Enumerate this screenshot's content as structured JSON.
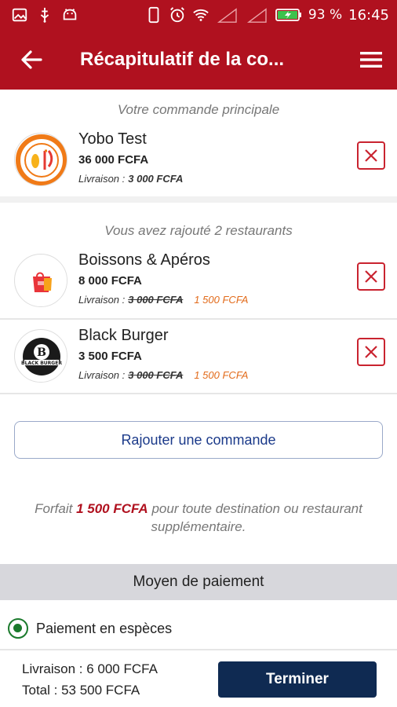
{
  "status_bar": {
    "battery": "93 %",
    "time": "16:45",
    "left_icons": [
      "image-icon",
      "usb-icon",
      "android-icon"
    ],
    "right_icons": [
      "phone-icon",
      "alarm-icon",
      "wifi-icon",
      "signal-icon",
      "signal-icon",
      "battery-icon"
    ]
  },
  "app_bar": {
    "title": "Récapitulatif de la co...",
    "back_icon": "arrow-left-icon",
    "menu_icon": "hamburger-menu-icon"
  },
  "main_order": {
    "section_title": "Votre commande principale",
    "name": "Yobo Test",
    "price": "36 000 FCFA",
    "delivery_label": "Livraison :",
    "delivery_fee": "3 000 FCFA"
  },
  "added": {
    "section_title": "Vous avez rajouté 2 restaurants",
    "items": [
      {
        "name": "Boissons & Apéros",
        "price": "8 000 FCFA",
        "delivery_label": "Livraison :",
        "old_fee": "3 000 FCFA",
        "new_fee": "1 500 FCFA"
      },
      {
        "name": "Black Burger",
        "price": "3 500 FCFA",
        "delivery_label": "Livraison :",
        "old_fee": "3 000 FCFA",
        "new_fee": "1 500 FCFA"
      }
    ]
  },
  "add_order_button": "Rajouter une commande",
  "note": {
    "prefix": "Forfait",
    "amount": "1 500 FCFA",
    "suffix": "pour toute destination ou restaurant supplémentaire."
  },
  "payment": {
    "header": "Moyen de paiement",
    "option": "Paiement en espèces",
    "selected": true
  },
  "footer": {
    "delivery_total": "Livraison : 6 000 FCFA",
    "total": "Total : 53 500 FCFA",
    "finish_button": "Terminer"
  },
  "colors": {
    "brand": "#b0111f",
    "navy": "#0f2a52",
    "accent_orange": "#e26b1b",
    "radio_green": "#1a7a2c"
  }
}
